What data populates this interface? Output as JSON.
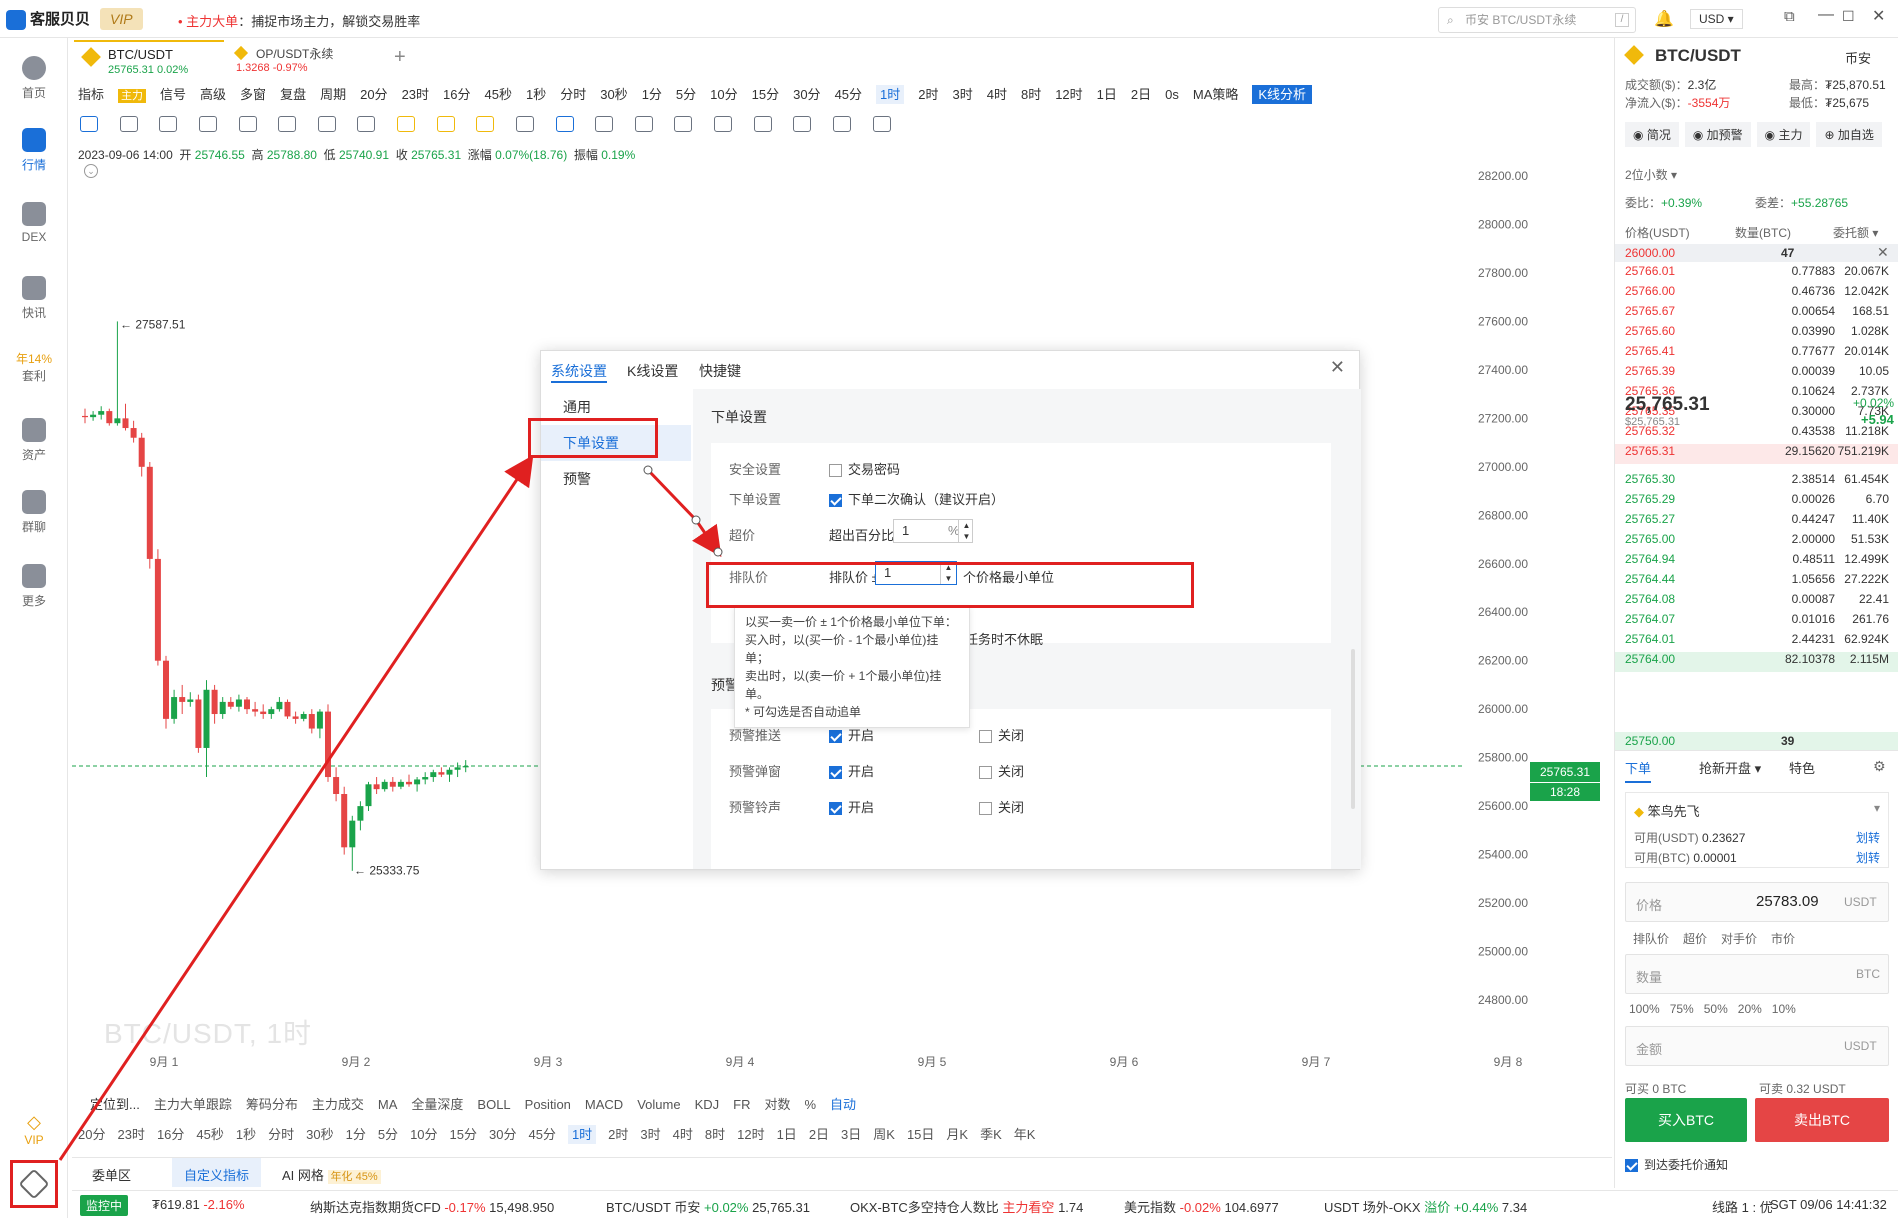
{
  "app": {
    "name": "客服贝贝",
    "vip": "VIP",
    "notice_label": "主力大单",
    "notice_text": "：捕捉市场主力，解锁交易胜率",
    "search_placeholder": "币安 BTC/USDT永续",
    "search_kbd": "/",
    "currency": "USD"
  },
  "nav": [
    {
      "label": "首页"
    },
    {
      "label": "行情"
    },
    {
      "label": "DEX"
    },
    {
      "label": "快讯"
    },
    {
      "label": "年14%",
      "sub": "套利"
    },
    {
      "label": "资产"
    },
    {
      "label": "群聊"
    },
    {
      "label": "更多"
    },
    {
      "label": "VIP"
    }
  ],
  "tabs": [
    {
      "title": "BTC/USDT",
      "price": "25765.31",
      "change": "0.02%"
    },
    {
      "title": "OP/USDT永续",
      "price": "1.3268",
      "change": "-0.97%"
    }
  ],
  "toolbar": [
    "指标",
    "主力",
    "信号",
    "高级",
    "多窗",
    "复盘",
    "周期",
    "20分",
    "23时",
    "16分",
    "45秒",
    "1秒",
    "分时",
    "30秒",
    "1分",
    "5分",
    "10分",
    "15分",
    "30分",
    "45分",
    "1时",
    "2时",
    "3时",
    "4时",
    "8时",
    "12时",
    "1日",
    "2日",
    "0s",
    "MA策略",
    "K线分析"
  ],
  "ohlc": {
    "date": "2023-09-06 14:00",
    "open_l": "开",
    "open": "25746.55",
    "high_l": "高",
    "high": "25788.80",
    "low_l": "低",
    "low": "25740.91",
    "close_l": "收",
    "close": "25765.31",
    "chg_l": "涨幅",
    "chg": "0.07%(18.76)",
    "amp_l": "振幅",
    "amp": "0.19%"
  },
  "chart_data": {
    "type": "candlestick",
    "ylim": [
      24800,
      28200
    ],
    "yticks": [
      "28200.00",
      "28000.00",
      "27800.00",
      "27600.00",
      "27400.00",
      "27200.00",
      "27000.00",
      "26800.00",
      "26600.00",
      "26400.00",
      "26200.00",
      "26000.00",
      "25800.00",
      "25600.00",
      "25400.00",
      "25200.00",
      "25000.00",
      "24800.00"
    ],
    "xticks": [
      "9月 1",
      "9月 2",
      "9月 3",
      "9月 4",
      "9月 5",
      "9月 6",
      "9月 7",
      "9月 8"
    ],
    "high_mark": "27587.51",
    "low_mark": "25333.75",
    "last_price": "25765.31",
    "countdown": "18:28",
    "watermark": "BTC/USDT, 1时"
  },
  "indicators": [
    "定位到...",
    "主力大单跟踪",
    "筹码分布",
    "主力成交",
    "MA",
    "全量深度",
    "BOLL",
    "Position",
    "MACD",
    "Volume",
    "KDJ",
    "FR",
    "对数",
    "%",
    "自动"
  ],
  "periods": [
    "20分",
    "23时",
    "16分",
    "45秒",
    "1秒",
    "分时",
    "30秒",
    "1分",
    "5分",
    "10分",
    "15分",
    "30分",
    "45分",
    "1时",
    "2时",
    "3时",
    "4时",
    "8时",
    "12时",
    "1日",
    "2日",
    "3日",
    "周K",
    "15日",
    "月K",
    "季K",
    "年K"
  ],
  "bottom_tabs": [
    "委单区",
    "自定义指标",
    "AI 网格",
    "年化 45%"
  ],
  "ticker": {
    "status": "监控中",
    "items": [
      {
        "name": "₮619.81",
        "chg": "-2.16%"
      },
      {
        "name": "纳斯达克指数期货CFD",
        "chg": "-0.17%",
        "val": "15,498.950"
      },
      {
        "name": "BTC/USDT 币安",
        "chg": "+0.02%",
        "val": "25,765.31"
      },
      {
        "name": "OKX-BTC多空持仓人数比",
        "chg": "主力看空",
        "val": "1.74"
      },
      {
        "name": "美元指数",
        "chg": "-0.02%",
        "val": "104.6977"
      },
      {
        "name": "USDT 场外-OKX",
        "chg": "溢价 +0.44%",
        "val": "7.34"
      }
    ],
    "line": "线路 1 : 优",
    "time": "SGT 09/06 14:41:32"
  },
  "right": {
    "pair": "BTC/USDT",
    "exchange": "币安",
    "vol_l": "成交额($)：",
    "vol": "2.3亿",
    "high_l": "最高：",
    "high": "₮25,870.51",
    "net_l": "净流入($)：",
    "net": "-3554万",
    "low_l": "最低：",
    "low": "₮25,675",
    "btns": [
      "简况",
      "加预警",
      "主力",
      "加自选"
    ],
    "decimals": "2位小数",
    "ratio_l": "委比：",
    "ratio": "+0.39%",
    "diff_l": "委差：",
    "diff": "+55.28765",
    "cols": [
      "价格(USDT)",
      "数量(BTC)",
      "委托额"
    ],
    "top_ask": {
      "p": "26000.00",
      "q": "47"
    },
    "asks": [
      {
        "p": "25766.01",
        "q": "0.77883",
        "t": "20.067K"
      },
      {
        "p": "25766.00",
        "q": "0.46736",
        "t": "12.042K"
      },
      {
        "p": "25765.67",
        "q": "0.00654",
        "t": "168.51"
      },
      {
        "p": "25765.60",
        "q": "0.03990",
        "t": "1.028K"
      },
      {
        "p": "25765.41",
        "q": "0.77677",
        "t": "20.014K"
      },
      {
        "p": "25765.39",
        "q": "0.00039",
        "t": "10.05"
      },
      {
        "p": "25765.36",
        "q": "0.10624",
        "t": "2.737K"
      },
      {
        "p": "25765.35",
        "q": "0.30000",
        "t": "7.73K"
      },
      {
        "p": "25765.32",
        "q": "0.43538",
        "t": "11.218K"
      },
      {
        "p": "25765.31",
        "q": "29.15620",
        "t": "751.219K"
      }
    ],
    "last": "25,765.31",
    "last_usd": "$25,765.31",
    "last_chg": "+0.02%",
    "last_diff": "+5.94",
    "bids": [
      {
        "p": "25765.30",
        "q": "2.38514",
        "t": "61.454K"
      },
      {
        "p": "25765.29",
        "q": "0.00026",
        "t": "6.70"
      },
      {
        "p": "25765.27",
        "q": "0.44247",
        "t": "11.40K"
      },
      {
        "p": "25765.00",
        "q": "2.00000",
        "t": "51.53K"
      },
      {
        "p": "25764.94",
        "q": "0.48511",
        "t": "12.499K"
      },
      {
        "p": "25764.44",
        "q": "1.05656",
        "t": "27.222K"
      },
      {
        "p": "25764.08",
        "q": "0.00087",
        "t": "22.41"
      },
      {
        "p": "25764.07",
        "q": "0.01016",
        "t": "261.76"
      },
      {
        "p": "25764.01",
        "q": "2.44231",
        "t": "62.924K"
      },
      {
        "p": "25764.00",
        "q": "82.10378",
        "t": "2.115M"
      }
    ],
    "bottom_bid": {
      "p": "25750.00",
      "q": "39"
    },
    "order_tabs": [
      "下单",
      "抢新开盘",
      "特色"
    ],
    "account": "笨鸟先飞",
    "avail_usdt_l": "可用(USDT)",
    "avail_usdt": "0.23627",
    "avail_btc_l": "可用(BTC)",
    "avail_btc": "0.00001",
    "transfer": "划转",
    "price_l": "价格",
    "price": "25783.09",
    "usdt": "USDT",
    "price_opts": [
      "排队价",
      "超价",
      "对手价",
      "市价"
    ],
    "qty_l": "数量",
    "btc": "BTC",
    "pcts": [
      "100%",
      "75%",
      "50%",
      "20%",
      "10%"
    ],
    "amount_l": "金额",
    "can_buy": "可买 0 BTC",
    "can_sell": "可卖 0.32 USDT",
    "buy": "买入BTC",
    "sell": "卖出BTC",
    "notify": "到达委托价通知"
  },
  "dialog": {
    "tabs": [
      "系统设置",
      "K线设置",
      "快捷键"
    ],
    "menu": [
      "通用",
      "下单设置",
      "预警"
    ],
    "sec1": "下单设置",
    "safe_l": "安全设置",
    "safe": "交易密码",
    "order_l": "下单设置",
    "order": "下单二次确认（建议开启）",
    "over_l": "超价",
    "over": "超出百分比",
    "over_v": "1",
    "pct": "%",
    "queue_l": "排队价",
    "queue": "排队价 ±",
    "queue_v": "1",
    "queue_unit": "个价格最小单位",
    "tip": [
      "以买一卖一价 ± 1个价格最小单位下单：",
      "买入时，以(买一价 - 1个最小单位)挂单；",
      "卖出时，以(卖一价 + 1个最小单位)挂单。",
      "* 可勾选是否自动追单"
    ],
    "sleep": "划单任务时不休眠",
    "sec2": "预警",
    "alerts": [
      {
        "l": "预警推送",
        "on": "开启",
        "off": "关闭"
      },
      {
        "l": "预警弹窗",
        "on": "开启",
        "off": "关闭"
      },
      {
        "l": "预警铃声",
        "on": "开启",
        "off": "关闭"
      }
    ]
  }
}
